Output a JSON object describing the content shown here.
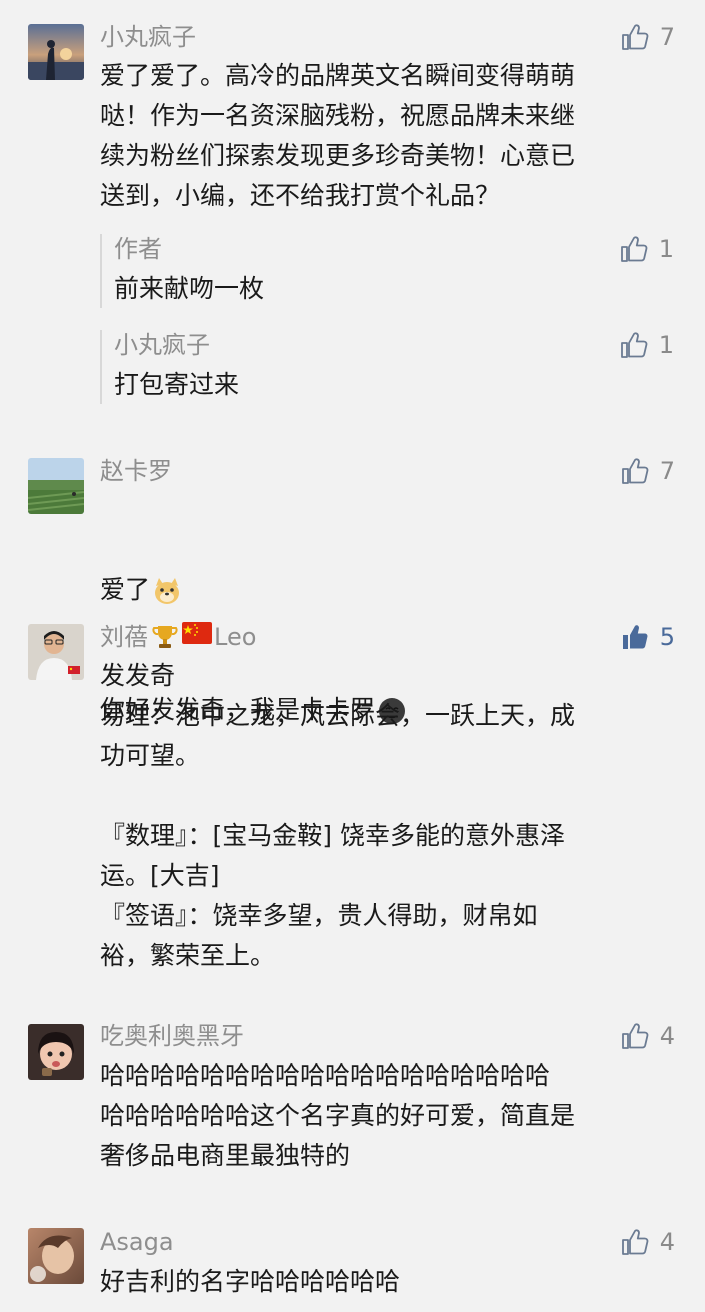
{
  "comments": [
    {
      "nick": "小丸疯子",
      "likes": "7",
      "text": "爱了爱了。高冷的品牌英文名瞬间变得萌萌\n哒！作为一名资深脑残粉，祝愿品牌未来继\n续为粉丝们探索发现更多珍奇美物！心意已\n送到，小编，还不给我打赏个礼品？",
      "replies": [
        {
          "nick": "作者",
          "text": "前来献吻一枚",
          "likes": "1"
        },
        {
          "nick": "小丸疯子",
          "text": "打包寄过来",
          "likes": "1"
        }
      ]
    },
    {
      "nick": "赵卡罗",
      "likes": "7",
      "line1": "爱了",
      "line2": "你好发发奇，我是卡卡罗"
    },
    {
      "nick_prefix": "刘蓓",
      "nick_suffix": "Leo",
      "likes": "5",
      "liked": true,
      "text": "发发奇\n易理：池中之龙，风云际会，一跃上天，成\n功可望。\n\n『数理』：[宝马金鞍] 饶幸多能的意外惠泽\n运。[大吉]\n『签语』：饶幸多望，贵人得助，财帛如\n裕，繁荣至上。"
    },
    {
      "nick": "吃奥利奥黑牙",
      "likes": "4",
      "text": "哈哈哈哈哈哈哈哈哈哈哈哈哈哈哈哈哈哈\n哈哈哈哈哈哈这个名字真的好可爱，简直是\n奢侈品电商里最独特的"
    },
    {
      "nick": "Asaga",
      "likes": "4",
      "text": "好吉利的名字哈哈哈哈哈哈"
    }
  ],
  "colors": {
    "background": "#f2f2f2",
    "nickname": "#8e8e8e",
    "text": "#1a1a1a",
    "like_active": "#4a6a9a"
  }
}
